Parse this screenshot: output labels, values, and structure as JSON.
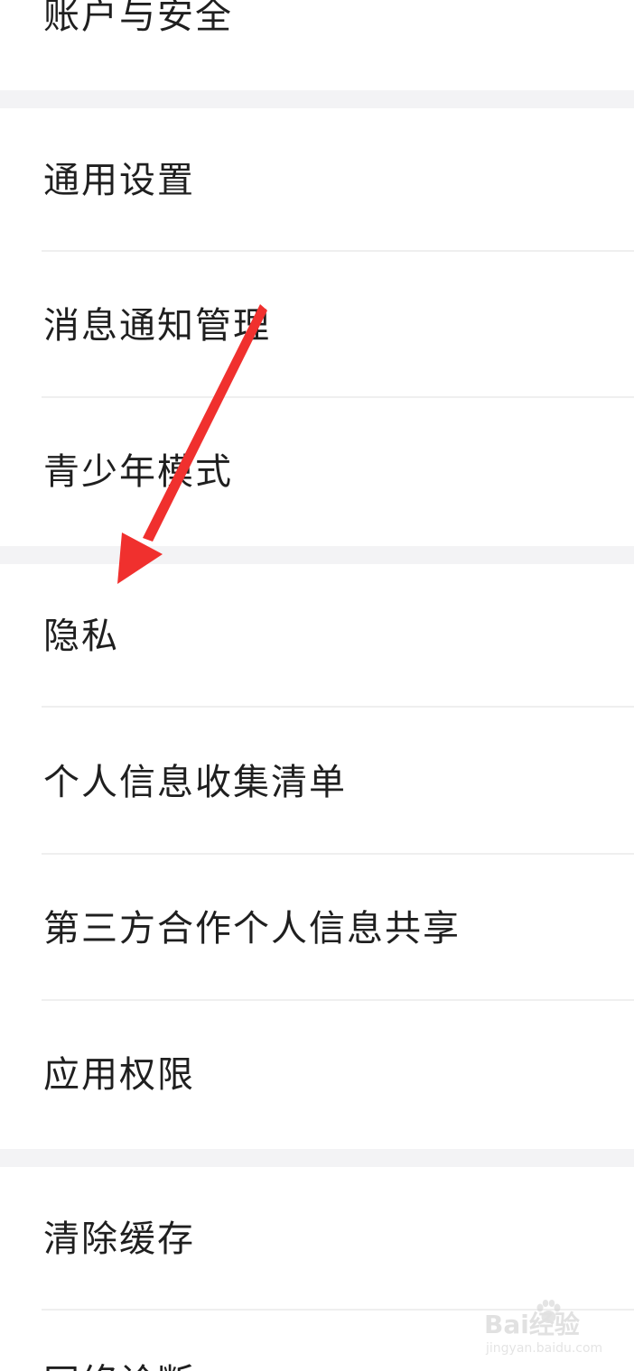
{
  "menu": {
    "account_security": "账户与安全",
    "general_settings": "通用设置",
    "notification_management": "消息通知管理",
    "teen_mode": "青少年模式",
    "privacy": "隐私",
    "personal_info_list": "个人信息收集清单",
    "third_party_sharing": "第三方合作个人信息共享",
    "app_permissions": "应用权限",
    "clear_cache": "清除缓存",
    "network_diagnosis": "网络诊断"
  },
  "annotation": {
    "arrow_color": "#f0302e",
    "arrow_target": "privacy"
  },
  "watermark": {
    "logo": "Bai经验",
    "url": "jingyan.baidu.com"
  },
  "colors": {
    "background": "#ffffff",
    "section_gap": "#f3f3f5",
    "divider": "#efefef",
    "text": "#1f1f1f"
  }
}
